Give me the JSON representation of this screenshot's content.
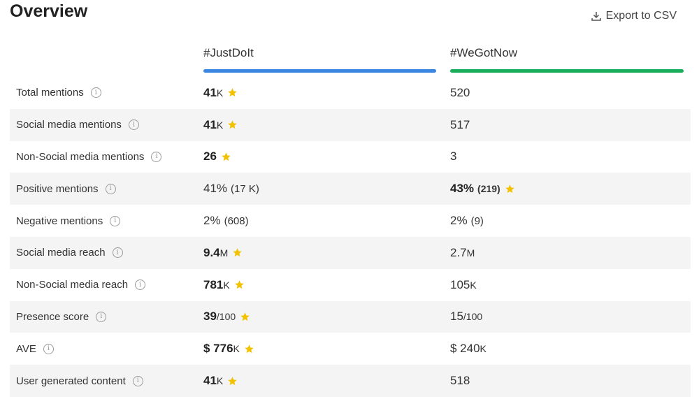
{
  "header": {
    "title": "Overview",
    "export_label": "Export to CSV"
  },
  "columns": [
    {
      "name": "#JustDoIt",
      "color": "#3b86e0"
    },
    {
      "name": "#WeGotNow",
      "color": "#1aad5a"
    }
  ],
  "colors": {
    "star": "#f2c200",
    "alt_row": "#f4f4f4"
  },
  "rows": [
    {
      "label": "Total mentions",
      "a": {
        "main": "41",
        "suffix": "K",
        "sub": "",
        "best": true
      },
      "b": {
        "main": "520",
        "suffix": "",
        "sub": "",
        "best": false
      }
    },
    {
      "label": "Social media mentions",
      "a": {
        "main": "41",
        "suffix": "K",
        "sub": "",
        "best": true
      },
      "b": {
        "main": "517",
        "suffix": "",
        "sub": "",
        "best": false
      }
    },
    {
      "label": "Non-Social media mentions",
      "a": {
        "main": "26",
        "suffix": "",
        "sub": "",
        "best": true
      },
      "b": {
        "main": "3",
        "suffix": "",
        "sub": "",
        "best": false
      }
    },
    {
      "label": "Positive mentions",
      "a": {
        "main": "41%",
        "suffix": "",
        "sub": "(17 K)",
        "best": false
      },
      "b": {
        "main": "43%",
        "suffix": "",
        "sub": "(219)",
        "best": true
      }
    },
    {
      "label": "Negative mentions",
      "a": {
        "main": "2%",
        "suffix": "",
        "sub": "(608)",
        "best": false
      },
      "b": {
        "main": "2%",
        "suffix": "",
        "sub": "(9)",
        "best": false
      }
    },
    {
      "label": "Social media reach",
      "a": {
        "main": "9.4",
        "suffix": "M",
        "sub": "",
        "best": true
      },
      "b": {
        "main": "2.7",
        "suffix": "M",
        "sub": "",
        "best": false
      }
    },
    {
      "label": "Non-Social media reach",
      "a": {
        "main": "781",
        "suffix": "K",
        "sub": "",
        "best": true
      },
      "b": {
        "main": "105",
        "suffix": "K",
        "sub": "",
        "best": false
      }
    },
    {
      "label": "Presence score",
      "a": {
        "main": "39",
        "suffix": "/100",
        "sub": "",
        "best": true
      },
      "b": {
        "main": "15",
        "suffix": "/100",
        "sub": "",
        "best": false
      }
    },
    {
      "label": "AVE",
      "a": {
        "main": "$ 776",
        "suffix": "K",
        "sub": "",
        "best": true
      },
      "b": {
        "main": "$ 240",
        "suffix": "K",
        "sub": "",
        "best": false
      }
    },
    {
      "label": "User generated content",
      "a": {
        "main": "41",
        "suffix": "K",
        "sub": "",
        "best": true
      },
      "b": {
        "main": "518",
        "suffix": "",
        "sub": "",
        "best": false
      }
    }
  ]
}
